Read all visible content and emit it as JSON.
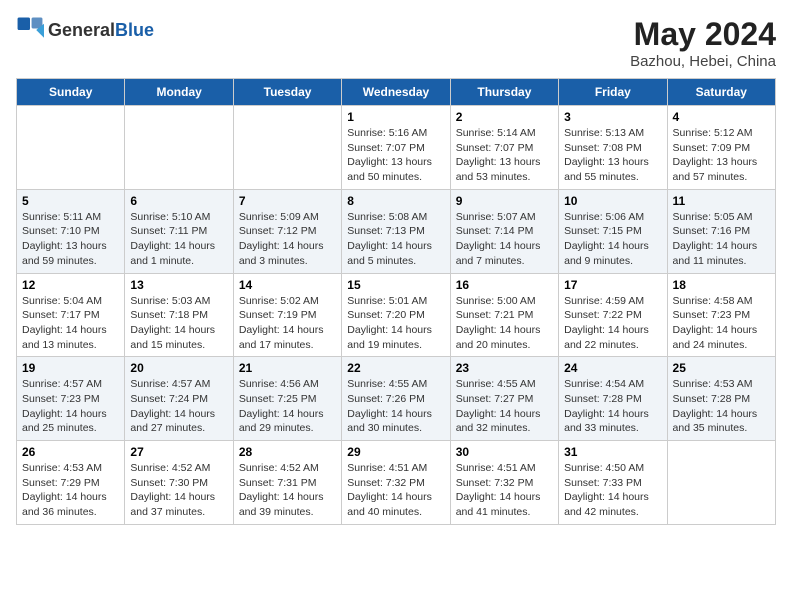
{
  "logo": {
    "text_general": "General",
    "text_blue": "Blue"
  },
  "header": {
    "month": "May 2024",
    "location": "Bazhou, Hebei, China"
  },
  "weekdays": [
    "Sunday",
    "Monday",
    "Tuesday",
    "Wednesday",
    "Thursday",
    "Friday",
    "Saturday"
  ],
  "weeks": [
    [
      {
        "day": "",
        "sunrise": "",
        "sunset": "",
        "daylight": ""
      },
      {
        "day": "",
        "sunrise": "",
        "sunset": "",
        "daylight": ""
      },
      {
        "day": "",
        "sunrise": "",
        "sunset": "",
        "daylight": ""
      },
      {
        "day": "1",
        "sunrise": "Sunrise: 5:16 AM",
        "sunset": "Sunset: 7:07 PM",
        "daylight": "Daylight: 13 hours and 50 minutes."
      },
      {
        "day": "2",
        "sunrise": "Sunrise: 5:14 AM",
        "sunset": "Sunset: 7:07 PM",
        "daylight": "Daylight: 13 hours and 53 minutes."
      },
      {
        "day": "3",
        "sunrise": "Sunrise: 5:13 AM",
        "sunset": "Sunset: 7:08 PM",
        "daylight": "Daylight: 13 hours and 55 minutes."
      },
      {
        "day": "4",
        "sunrise": "Sunrise: 5:12 AM",
        "sunset": "Sunset: 7:09 PM",
        "daylight": "Daylight: 13 hours and 57 minutes."
      }
    ],
    [
      {
        "day": "5",
        "sunrise": "Sunrise: 5:11 AM",
        "sunset": "Sunset: 7:10 PM",
        "daylight": "Daylight: 13 hours and 59 minutes."
      },
      {
        "day": "6",
        "sunrise": "Sunrise: 5:10 AM",
        "sunset": "Sunset: 7:11 PM",
        "daylight": "Daylight: 14 hours and 1 minute."
      },
      {
        "day": "7",
        "sunrise": "Sunrise: 5:09 AM",
        "sunset": "Sunset: 7:12 PM",
        "daylight": "Daylight: 14 hours and 3 minutes."
      },
      {
        "day": "8",
        "sunrise": "Sunrise: 5:08 AM",
        "sunset": "Sunset: 7:13 PM",
        "daylight": "Daylight: 14 hours and 5 minutes."
      },
      {
        "day": "9",
        "sunrise": "Sunrise: 5:07 AM",
        "sunset": "Sunset: 7:14 PM",
        "daylight": "Daylight: 14 hours and 7 minutes."
      },
      {
        "day": "10",
        "sunrise": "Sunrise: 5:06 AM",
        "sunset": "Sunset: 7:15 PM",
        "daylight": "Daylight: 14 hours and 9 minutes."
      },
      {
        "day": "11",
        "sunrise": "Sunrise: 5:05 AM",
        "sunset": "Sunset: 7:16 PM",
        "daylight": "Daylight: 14 hours and 11 minutes."
      }
    ],
    [
      {
        "day": "12",
        "sunrise": "Sunrise: 5:04 AM",
        "sunset": "Sunset: 7:17 PM",
        "daylight": "Daylight: 14 hours and 13 minutes."
      },
      {
        "day": "13",
        "sunrise": "Sunrise: 5:03 AM",
        "sunset": "Sunset: 7:18 PM",
        "daylight": "Daylight: 14 hours and 15 minutes."
      },
      {
        "day": "14",
        "sunrise": "Sunrise: 5:02 AM",
        "sunset": "Sunset: 7:19 PM",
        "daylight": "Daylight: 14 hours and 17 minutes."
      },
      {
        "day": "15",
        "sunrise": "Sunrise: 5:01 AM",
        "sunset": "Sunset: 7:20 PM",
        "daylight": "Daylight: 14 hours and 19 minutes."
      },
      {
        "day": "16",
        "sunrise": "Sunrise: 5:00 AM",
        "sunset": "Sunset: 7:21 PM",
        "daylight": "Daylight: 14 hours and 20 minutes."
      },
      {
        "day": "17",
        "sunrise": "Sunrise: 4:59 AM",
        "sunset": "Sunset: 7:22 PM",
        "daylight": "Daylight: 14 hours and 22 minutes."
      },
      {
        "day": "18",
        "sunrise": "Sunrise: 4:58 AM",
        "sunset": "Sunset: 7:23 PM",
        "daylight": "Daylight: 14 hours and 24 minutes."
      }
    ],
    [
      {
        "day": "19",
        "sunrise": "Sunrise: 4:57 AM",
        "sunset": "Sunset: 7:23 PM",
        "daylight": "Daylight: 14 hours and 25 minutes."
      },
      {
        "day": "20",
        "sunrise": "Sunrise: 4:57 AM",
        "sunset": "Sunset: 7:24 PM",
        "daylight": "Daylight: 14 hours and 27 minutes."
      },
      {
        "day": "21",
        "sunrise": "Sunrise: 4:56 AM",
        "sunset": "Sunset: 7:25 PM",
        "daylight": "Daylight: 14 hours and 29 minutes."
      },
      {
        "day": "22",
        "sunrise": "Sunrise: 4:55 AM",
        "sunset": "Sunset: 7:26 PM",
        "daylight": "Daylight: 14 hours and 30 minutes."
      },
      {
        "day": "23",
        "sunrise": "Sunrise: 4:55 AM",
        "sunset": "Sunset: 7:27 PM",
        "daylight": "Daylight: 14 hours and 32 minutes."
      },
      {
        "day": "24",
        "sunrise": "Sunrise: 4:54 AM",
        "sunset": "Sunset: 7:28 PM",
        "daylight": "Daylight: 14 hours and 33 minutes."
      },
      {
        "day": "25",
        "sunrise": "Sunrise: 4:53 AM",
        "sunset": "Sunset: 7:28 PM",
        "daylight": "Daylight: 14 hours and 35 minutes."
      }
    ],
    [
      {
        "day": "26",
        "sunrise": "Sunrise: 4:53 AM",
        "sunset": "Sunset: 7:29 PM",
        "daylight": "Daylight: 14 hours and 36 minutes."
      },
      {
        "day": "27",
        "sunrise": "Sunrise: 4:52 AM",
        "sunset": "Sunset: 7:30 PM",
        "daylight": "Daylight: 14 hours and 37 minutes."
      },
      {
        "day": "28",
        "sunrise": "Sunrise: 4:52 AM",
        "sunset": "Sunset: 7:31 PM",
        "daylight": "Daylight: 14 hours and 39 minutes."
      },
      {
        "day": "29",
        "sunrise": "Sunrise: 4:51 AM",
        "sunset": "Sunset: 7:32 PM",
        "daylight": "Daylight: 14 hours and 40 minutes."
      },
      {
        "day": "30",
        "sunrise": "Sunrise: 4:51 AM",
        "sunset": "Sunset: 7:32 PM",
        "daylight": "Daylight: 14 hours and 41 minutes."
      },
      {
        "day": "31",
        "sunrise": "Sunrise: 4:50 AM",
        "sunset": "Sunset: 7:33 PM",
        "daylight": "Daylight: 14 hours and 42 minutes."
      },
      {
        "day": "",
        "sunrise": "",
        "sunset": "",
        "daylight": ""
      }
    ]
  ]
}
